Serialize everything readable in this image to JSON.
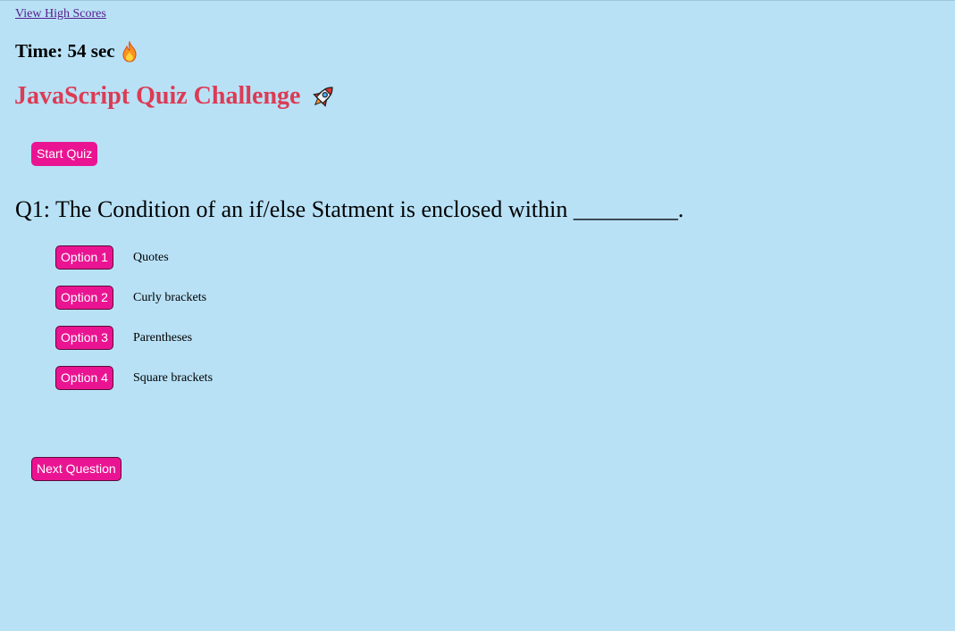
{
  "nav": {
    "high_scores_label": "View High Scores"
  },
  "timer": {
    "label": "Time: 54 sec"
  },
  "header": {
    "title": "JavaScript Quiz Challenge"
  },
  "controls": {
    "start_label": "Start Quiz",
    "next_label": "Next Question"
  },
  "question": {
    "text": "Q1: The Condition of an if/else Statment is enclosed within _________."
  },
  "options": [
    {
      "button_label": "Option 1",
      "text": "Quotes"
    },
    {
      "button_label": "Option 2",
      "text": "Curly brackets"
    },
    {
      "button_label": "Option 3",
      "text": "Parentheses"
    },
    {
      "button_label": "Option 4",
      "text": "Square brackets"
    }
  ],
  "icons": {
    "timer": "fire-icon",
    "title": "rocket-icon"
  },
  "colors": {
    "background": "#b8e1f6",
    "accent_button": "#ea1492",
    "title": "#dc3b54",
    "link": "#551a8b"
  }
}
